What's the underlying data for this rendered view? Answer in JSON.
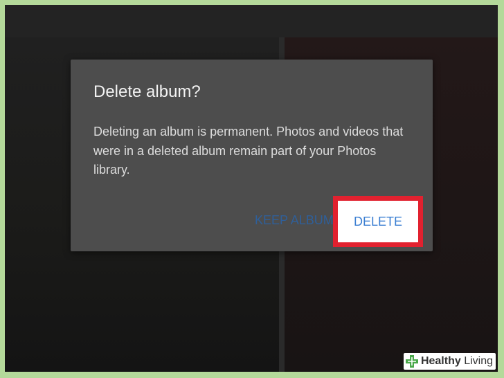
{
  "dialog": {
    "title": "Delete album?",
    "body": "Deleting an album is permanent. Photos and videos that were in a deleted album remain part of your Photos library.",
    "keep_label": "KEEP ALBUM",
    "delete_label": "DELETE"
  },
  "watermark": {
    "brand_bold": "Healthy",
    "brand_light": " Living",
    "icon": "plus-cross-icon"
  },
  "colors": {
    "highlight_border": "#e1212f",
    "primary_action": "#3c7fd2",
    "dialog_background": "#4d4d4d",
    "brand_green": "#4aa84a"
  }
}
